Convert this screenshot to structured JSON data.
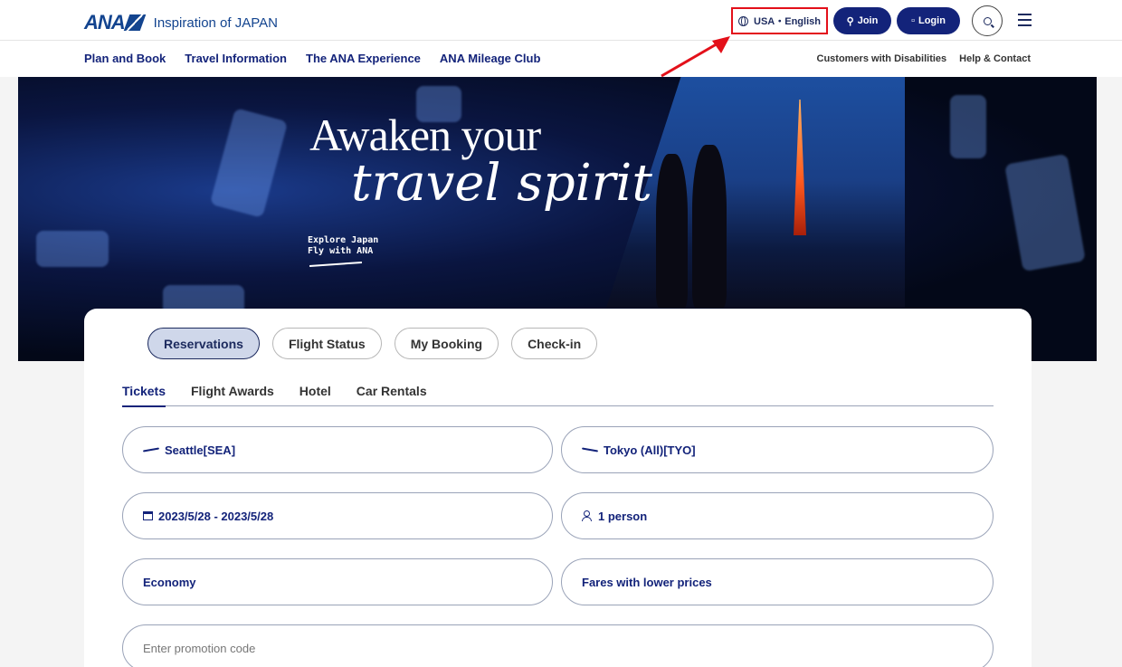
{
  "header": {
    "logo_text": "ANA",
    "tagline": "Inspiration of JAPAN",
    "locale": "USA・English",
    "join": "Join",
    "login": "Login"
  },
  "nav": {
    "main": [
      "Plan and Book",
      "Travel Information",
      "The ANA Experience",
      "ANA Mileage Club"
    ],
    "secondary": [
      "Customers with Disabilities",
      "Help & Contact"
    ]
  },
  "hero": {
    "title_line1": "Awaken your",
    "title_line2": "travel spirit",
    "sub_line1": "Explore Japan",
    "sub_line2": "Fly with ANA"
  },
  "booking": {
    "top_tabs": [
      "Reservations",
      "Flight Status",
      "My Booking",
      "Check-in"
    ],
    "active_top_tab": "Reservations",
    "sub_tabs": [
      "Tickets",
      "Flight Awards",
      "Hotel",
      "Car Rentals"
    ],
    "active_sub_tab": "Tickets",
    "origin": "Seattle[SEA]",
    "destination": "Tokyo (All)[TYO]",
    "dates": "2023/5/28 - 2023/5/28",
    "passengers": "1 person",
    "cabin": "Economy",
    "fare_type": "Fares with lower prices",
    "promo_placeholder": "Enter promotion code"
  },
  "colors": {
    "brand_navy": "#13237a",
    "highlight_red": "#e3101a",
    "active_pill_bg": "#cfd7ea"
  }
}
